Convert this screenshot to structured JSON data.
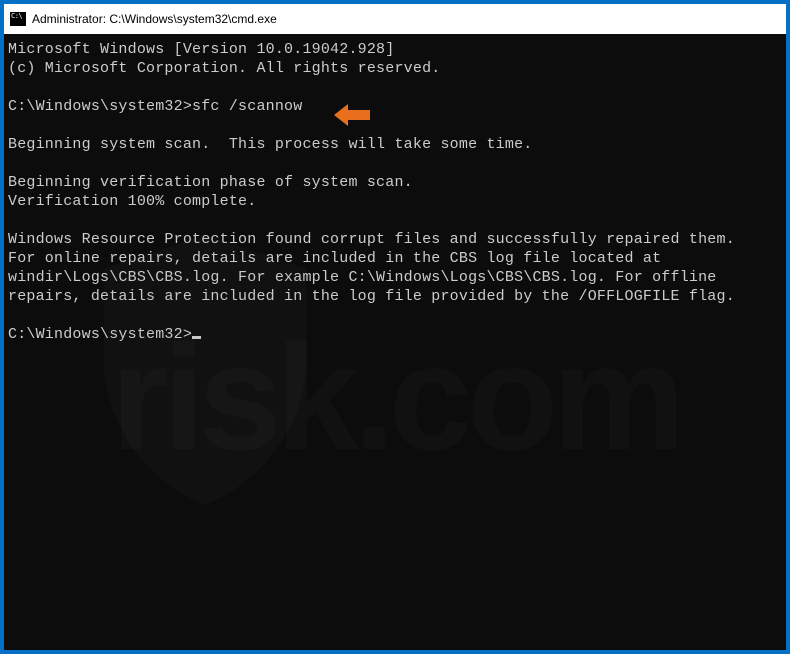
{
  "window": {
    "title": "Administrator: C:\\Windows\\system32\\cmd.exe"
  },
  "terminal": {
    "line1": "Microsoft Windows [Version 10.0.19042.928]",
    "line2": "(c) Microsoft Corporation. All rights reserved.",
    "blank1": "",
    "prompt1_path": "C:\\Windows\\system32>",
    "prompt1_cmd": "sfc /scannow",
    "blank2": "",
    "line3": "Beginning system scan.  This process will take some time.",
    "blank3": "",
    "line4": "Beginning verification phase of system scan.",
    "line5": "Verification 100% complete.",
    "blank4": "",
    "line6": "Windows Resource Protection found corrupt files and successfully repaired them.",
    "line7": "For online repairs, details are included in the CBS log file located at",
    "line8": "windir\\Logs\\CBS\\CBS.log. For example C:\\Windows\\Logs\\CBS\\CBS.log. For offline",
    "line9": "repairs, details are included in the log file provided by the /OFFLOGFILE flag.",
    "blank5": "",
    "prompt2_path": "C:\\Windows\\system32>"
  },
  "annotation": {
    "arrow_color": "#e8701c"
  },
  "watermark": {
    "text": "risk.com"
  }
}
